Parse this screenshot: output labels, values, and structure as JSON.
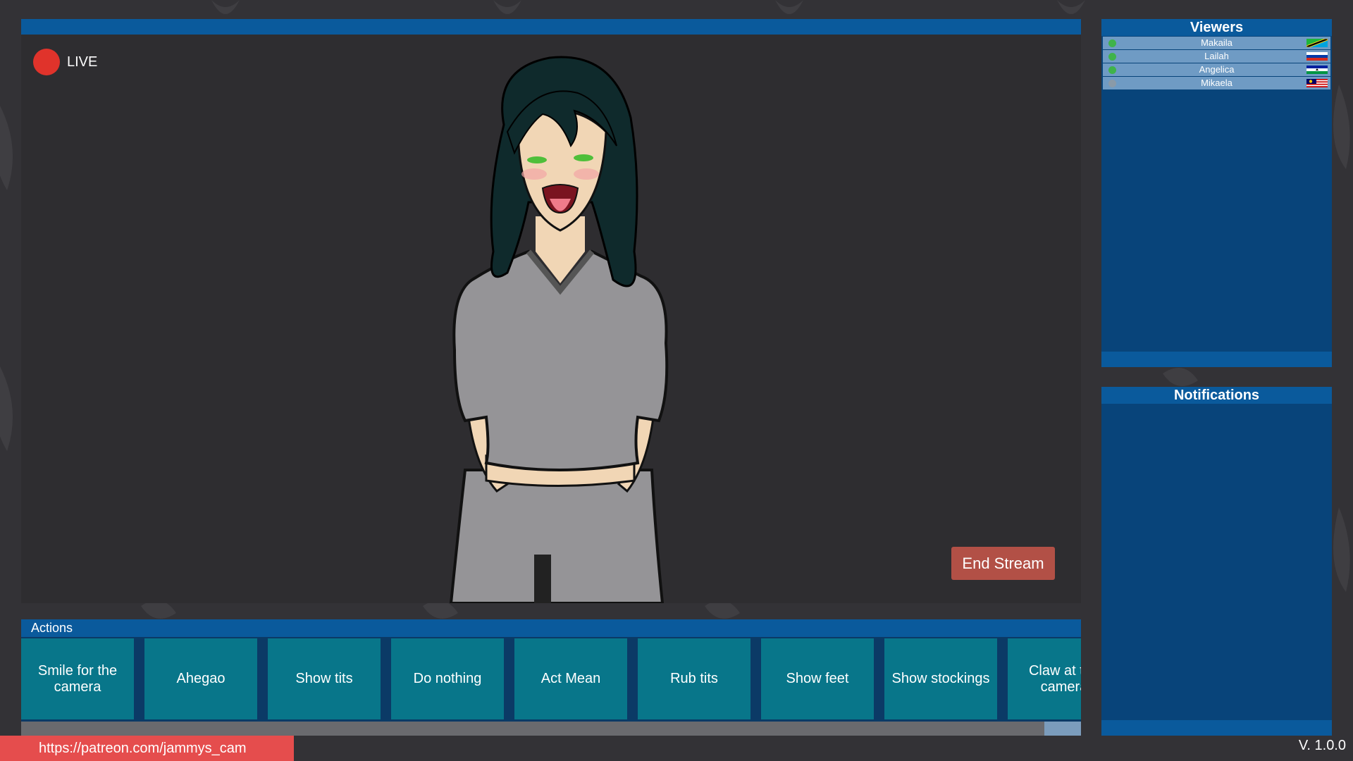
{
  "stream": {
    "live_label": "LIVE",
    "end_stream_label": "End Stream"
  },
  "actions": {
    "title": "Actions",
    "buttons": [
      {
        "label": "Smile for the camera"
      },
      {
        "label": "Ahegao"
      },
      {
        "label": "Show tits"
      },
      {
        "label": "Do nothing"
      },
      {
        "label": "Act Mean"
      },
      {
        "label": "Rub tits"
      },
      {
        "label": "Show feet"
      },
      {
        "label": "Show stockings"
      },
      {
        "label": "Claw at the camera"
      }
    ]
  },
  "viewers": {
    "title": "Viewers",
    "list": [
      {
        "name": "Makaila",
        "status": "online",
        "flag": "tanzania-flag"
      },
      {
        "name": "Lailah",
        "status": "online",
        "flag": "russia-flag"
      },
      {
        "name": "Angelica",
        "status": "online",
        "flag": "lesotho-flag"
      },
      {
        "name": "Mikaela",
        "status": "offline",
        "flag": "malaysia-flag"
      }
    ]
  },
  "notifications": {
    "title": "Notifications"
  },
  "footer": {
    "patreon_link": "https://patreon.com/jammys_cam",
    "version": "V. 1.0.0"
  },
  "colors": {
    "online": "#3fb34a",
    "offline": "#8a9aa8",
    "live": "#e0332b",
    "accent": "#0a5a9c"
  }
}
